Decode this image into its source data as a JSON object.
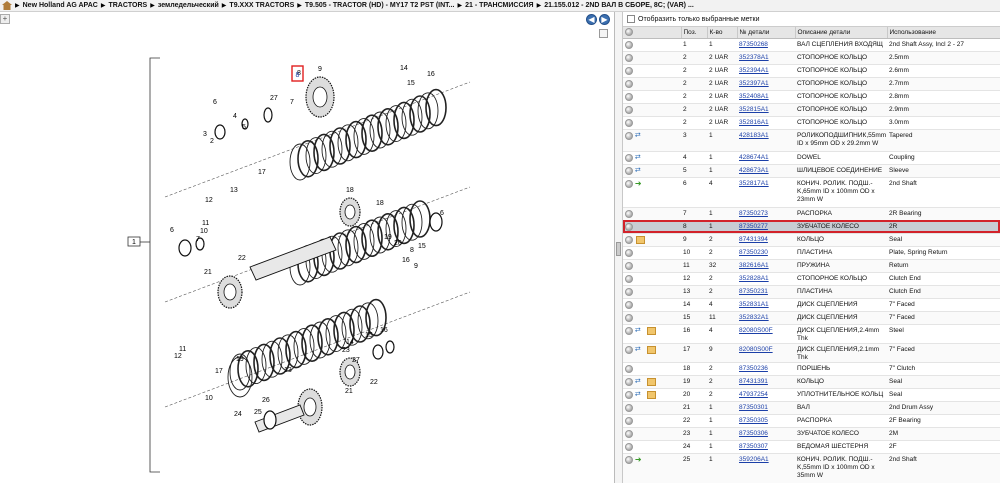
{
  "breadcrumb": [
    "New Holland AG APAC",
    "TRACTORS",
    "земледельческий",
    "T9.XXX TRACTORS",
    "T9.505 - TRACTOR (HD) - MY17 T2 PST (INT...",
    "21 - ТРАНСМИССИЯ",
    "21.155.012 - 2ND ВАЛ В СБОРЕ, 8C; (VAR) ..."
  ],
  "filter": {
    "label": "Отобразить только выбранные метки"
  },
  "table": {
    "headers": [
      "Поз.",
      "К-во",
      "№ детали",
      "Описание детали",
      "Использование"
    ],
    "rows": [
      {
        "pos": "1",
        "qty": "1",
        "uom": "",
        "part": "87350268",
        "desc": "ВАЛ СЦЕПЛЕНИЯ ВХОДЯЩ",
        "use": "2nd Shaft Assy, Incl 2 - 27",
        "icons": []
      },
      {
        "pos": "2",
        "qty": "2",
        "uom": "UAR",
        "part": "352378A1",
        "desc": "СТОПОРНОЕ КОЛЬЦО",
        "use": "2.5mm",
        "icons": []
      },
      {
        "pos": "2",
        "qty": "2",
        "uom": "UAR",
        "part": "352394A1",
        "desc": "СТОПОРНОЕ КОЛЬЦО",
        "use": "2.6mm",
        "icons": []
      },
      {
        "pos": "2",
        "qty": "2",
        "uom": "UAR",
        "part": "352397A1",
        "desc": "СТОПОРНОЕ КОЛЬЦО",
        "use": "2.7mm",
        "icons": []
      },
      {
        "pos": "2",
        "qty": "2",
        "uom": "UAR",
        "part": "352408A1",
        "desc": "СТОПОРНОЕ КОЛЬЦО",
        "use": "2.8mm",
        "icons": []
      },
      {
        "pos": "2",
        "qty": "2",
        "uom": "UAR",
        "part": "352815A1",
        "desc": "СТОПОРНОЕ КОЛЬЦО",
        "use": "2.9mm",
        "icons": []
      },
      {
        "pos": "2",
        "qty": "2",
        "uom": "UAR",
        "part": "352816A1",
        "desc": "СТОПОРНОЕ КОЛЬЦО",
        "use": "3.0mm",
        "icons": []
      },
      {
        "pos": "3",
        "qty": "1",
        "uom": "",
        "part": "428183A1",
        "desc": "РОЛИКОПОДШИПНИК,55mm ID x 95mm OD x 29.2mm W",
        "use": "Tapered",
        "icons": [
          "swap"
        ],
        "lines": 2
      },
      {
        "pos": "4",
        "qty": "1",
        "uom": "",
        "part": "428674A1",
        "desc": "DOWEL",
        "use": "Coupling",
        "icons": [
          "swap"
        ]
      },
      {
        "pos": "5",
        "qty": "1",
        "uom": "",
        "part": "428673A1",
        "desc": "ШЛИЦЕВОЕ СОЕДИНЕНИЕ",
        "use": "Sleeve",
        "icons": [
          "swap"
        ]
      },
      {
        "pos": "6",
        "qty": "4",
        "uom": "",
        "part": "352817A1",
        "desc": "КОНИЧ. РОЛИК. ПОДШ.-K,65mm ID x 100mm OD x 23mm W",
        "use": "2nd Shaft",
        "icons": [
          "green"
        ],
        "lines": 3
      },
      {
        "pos": "7",
        "qty": "1",
        "uom": "",
        "part": "87350273",
        "desc": "РАСПОРКА",
        "use": "2R Bearing",
        "icons": []
      },
      {
        "pos": "8",
        "qty": "1",
        "uom": "",
        "part": "87350277",
        "desc": "ЗУБЧАТОЕ КОЛЕСО",
        "use": "2R",
        "icons": [],
        "selected": true
      },
      {
        "pos": "9",
        "qty": "2",
        "uom": "",
        "part": "87431394",
        "desc": "КОЛЬЦО",
        "use": "Seal",
        "icons": [
          "box"
        ]
      },
      {
        "pos": "10",
        "qty": "2",
        "uom": "",
        "part": "87350230",
        "desc": "ПЛАСТИНА",
        "use": "Plate, Spring Return",
        "icons": []
      },
      {
        "pos": "11",
        "qty": "32",
        "uom": "",
        "part": "382616A1",
        "desc": "ПРУЖИНА",
        "use": "Return",
        "icons": []
      },
      {
        "pos": "12",
        "qty": "2",
        "uom": "",
        "part": "352828A1",
        "desc": "СТОПОРНОЕ КОЛЬЦО",
        "use": "Clutch End",
        "icons": []
      },
      {
        "pos": "13",
        "qty": "2",
        "uom": "",
        "part": "87350231",
        "desc": "ПЛАСТИНА",
        "use": "Clutch End",
        "icons": []
      },
      {
        "pos": "14",
        "qty": "4",
        "uom": "",
        "part": "352831A1",
        "desc": "ДИСК СЦЕПЛЕНИЯ",
        "use": "7\" Faced",
        "icons": []
      },
      {
        "pos": "15",
        "qty": "11",
        "uom": "",
        "part": "352832A1",
        "desc": "ДИСК СЦЕПЛЕНИЯ",
        "use": "7\" Faced",
        "icons": []
      },
      {
        "pos": "16",
        "qty": "4",
        "uom": "",
        "part": "82080S00F",
        "desc": "ДИСК СЦЕПЛЕНИЯ,2.4mm Thk",
        "use": "Steel",
        "icons": [
          "swap",
          "box"
        ]
      },
      {
        "pos": "17",
        "qty": "9",
        "uom": "",
        "part": "82080S00F",
        "desc": "ДИСК СЦЕПЛЕНИЯ,2.1mm Thk",
        "use": "7\" Faced",
        "icons": [
          "swap",
          "box"
        ]
      },
      {
        "pos": "18",
        "qty": "2",
        "uom": "",
        "part": "87350236",
        "desc": "ПОРШЕНЬ",
        "use": "7\" Clutch",
        "icons": []
      },
      {
        "pos": "19",
        "qty": "2",
        "uom": "",
        "part": "87431391",
        "desc": "КОЛЬЦО",
        "use": "Seal",
        "icons": [
          "swap",
          "box"
        ]
      },
      {
        "pos": "20",
        "qty": "2",
        "uom": "",
        "part": "47937254",
        "desc": "УПЛОТНИТЕЛЬНОЕ КОЛЬЦ",
        "use": "Seal",
        "icons": [
          "swap",
          "box"
        ]
      },
      {
        "pos": "21",
        "qty": "1",
        "uom": "",
        "part": "87350301",
        "desc": "ВАЛ",
        "use": "2nd Drum Assy",
        "icons": []
      },
      {
        "pos": "22",
        "qty": "1",
        "uom": "",
        "part": "87350305",
        "desc": "РАСПОРКА",
        "use": "2F Bearing",
        "icons": []
      },
      {
        "pos": "23",
        "qty": "1",
        "uom": "",
        "part": "87350306",
        "desc": "ЗУБЧАТОЕ КОЛЕСО",
        "use": "2M",
        "icons": []
      },
      {
        "pos": "24",
        "qty": "1",
        "uom": "",
        "part": "87350307",
        "desc": "ВЕДОМАЯ ШЕСТЕРНЯ",
        "use": "2F",
        "icons": []
      },
      {
        "pos": "25",
        "qty": "1",
        "uom": "",
        "part": "359206A1",
        "desc": "КОНИЧ. РОЛИК. ПОДШ.-K,55mm ID x 100mm OD x 35mm W",
        "use": "2nd Shaft",
        "icons": [
          "green"
        ],
        "lines": 3
      }
    ]
  },
  "diagram": {
    "callout_box": "1",
    "highlight_label": "8",
    "labels": [
      "9",
      "16",
      "15",
      "14",
      "6",
      "27",
      "7",
      "8",
      "4",
      "5",
      "3",
      "2",
      "18",
      "17",
      "13",
      "12",
      "11",
      "10",
      "6",
      "7",
      "6",
      "18",
      "19",
      "20",
      "21",
      "22",
      "19",
      "17",
      "10",
      "11",
      "12",
      "16",
      "15",
      "14",
      "13",
      "26",
      "25",
      "24",
      "23",
      "27",
      "22",
      "21",
      "8",
      "9",
      "16",
      "15",
      "14",
      "13",
      "12",
      "11",
      "10",
      "2"
    ]
  }
}
